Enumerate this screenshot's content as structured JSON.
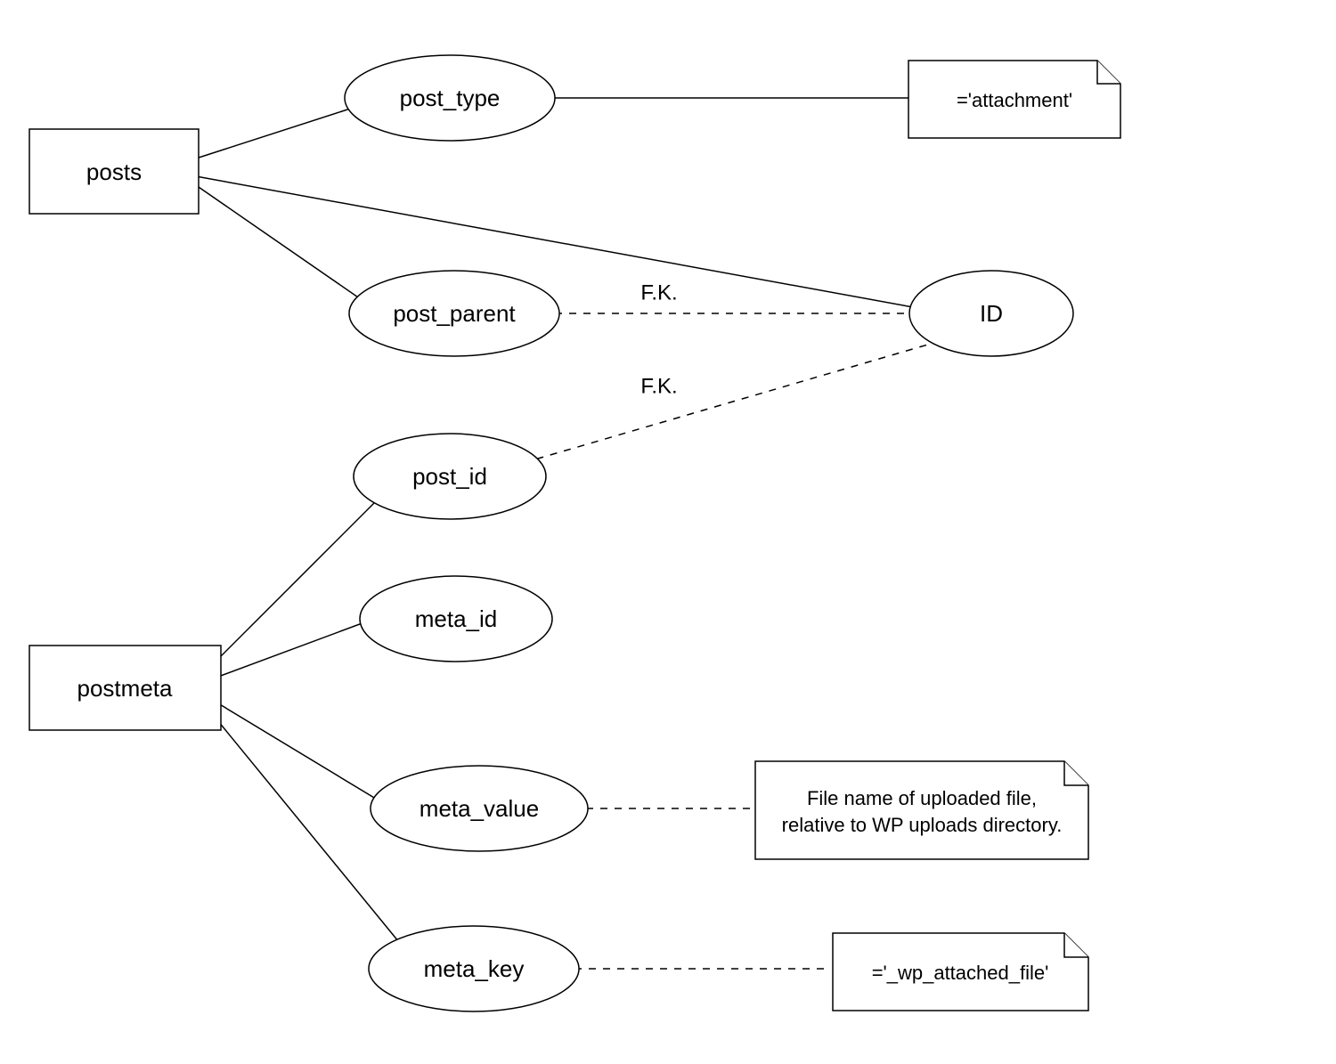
{
  "entities": {
    "posts": "posts",
    "postmeta": "postmeta"
  },
  "attributes": {
    "post_type": "post_type",
    "post_parent": "post_parent",
    "id": "ID",
    "post_id": "post_id",
    "meta_id": "meta_id",
    "meta_value": "meta_value",
    "meta_key": "meta_key"
  },
  "notes": {
    "attachment": "='attachment'",
    "meta_value_line1": "File name of uploaded file,",
    "meta_value_line2": "relative to WP uploads directory.",
    "wp_attached_file": "='_wp_attached_file'"
  },
  "edge_labels": {
    "fk1": "F.K.",
    "fk2": "F.K."
  }
}
